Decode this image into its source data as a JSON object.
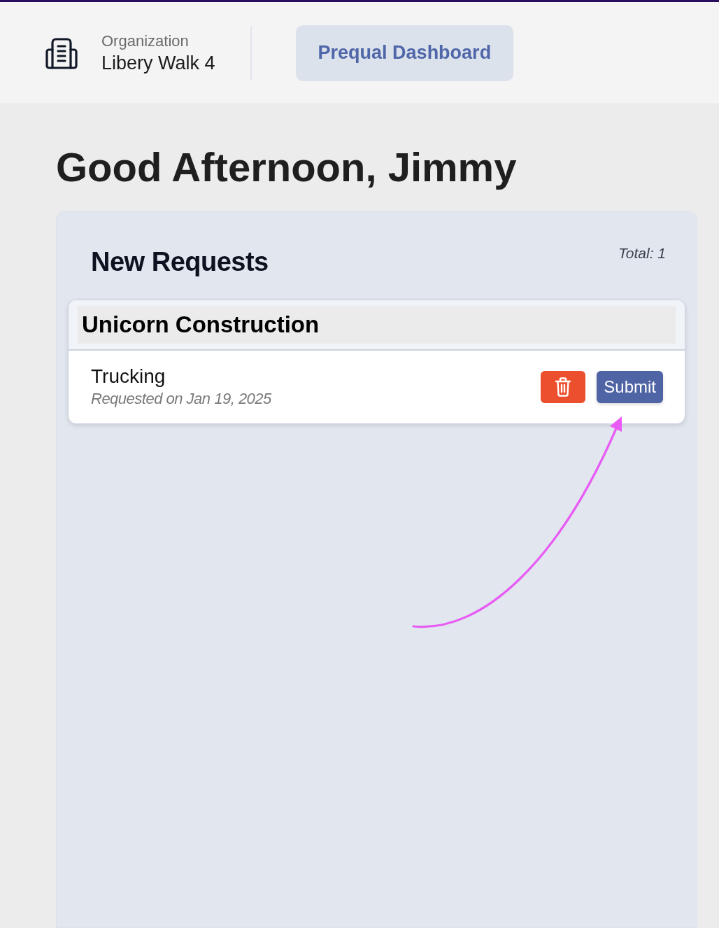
{
  "header": {
    "organization_label": "Organization",
    "organization_name": "Libery Walk 4",
    "nav_button": "Prequal Dashboard"
  },
  "greeting": "Good Afternoon, Jimmy",
  "requests_panel": {
    "title": "New Requests",
    "total": "Total: 1",
    "groups": [
      {
        "company": "Unicorn Construction",
        "requests": [
          {
            "service": "Trucking",
            "requested": "Requested on Jan 19, 2025",
            "submit_label": "Submit"
          }
        ]
      }
    ]
  }
}
